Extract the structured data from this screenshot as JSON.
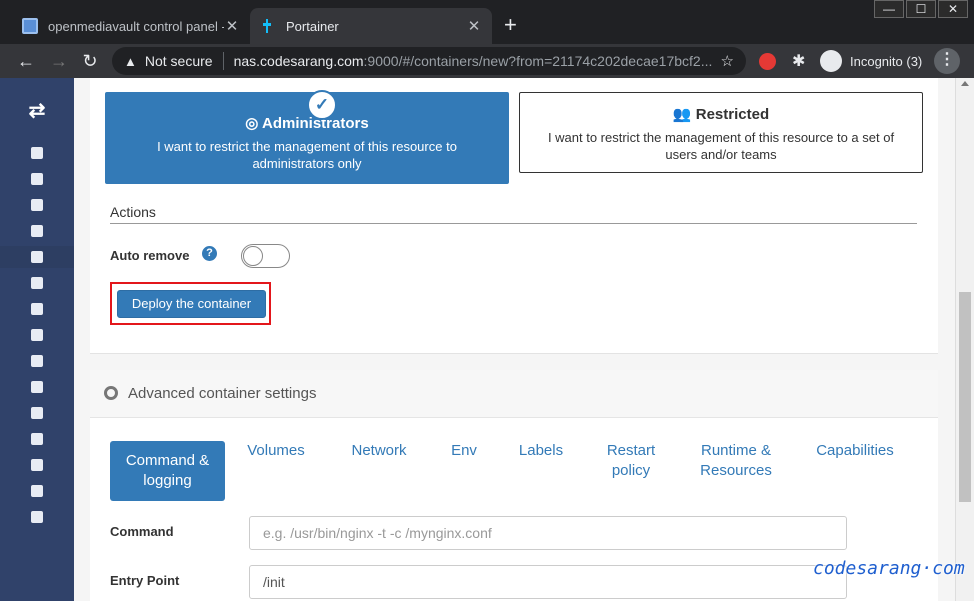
{
  "browser": {
    "tabs": [
      {
        "title": "openmediavault control panel - c",
        "active": false,
        "favicon": "omv-icon"
      },
      {
        "title": "Portainer",
        "active": true,
        "favicon": "portainer-icon"
      }
    ],
    "new_tab": "+",
    "window_controls": [
      "—",
      "☐",
      "✕"
    ],
    "security_label": "Not secure",
    "url_host": "nas.codesarang.com",
    "url_path": ":9000/#/containers/new?from=21174c202decae17bcf2...",
    "incognito_label": "Incognito (3)"
  },
  "sidebar": {
    "logo": "⇄",
    "items": [
      "home-icon",
      "dashboard-icon",
      "app-templates-icon",
      "stacks-icon",
      "containers-icon",
      "images-icon",
      "networks-icon",
      "volumes-icon",
      "events-icon",
      "host-icon",
      "extensions-icon",
      "users-icon",
      "endpoints-icon",
      "registries-icon",
      "settings-icon"
    ],
    "active_index": 4
  },
  "access_control": {
    "admin": {
      "title": "Administrators",
      "description": "I want to restrict the management of this resource to administrators only",
      "selected": true
    },
    "restricted": {
      "title": "Restricted",
      "description": "I want to restrict the management of this resource to a set of users and/or teams",
      "selected": false
    }
  },
  "actions": {
    "title": "Actions",
    "auto_remove_label": "Auto remove",
    "auto_remove_on": false,
    "help": "?",
    "deploy_label": "Deploy the container"
  },
  "advanced": {
    "title": "Advanced container settings",
    "tabs": [
      "Command & logging",
      "Volumes",
      "Network",
      "Env",
      "Labels",
      "Restart policy",
      "Runtime & Resources",
      "Capabilities"
    ],
    "active_tab": 0,
    "command_label": "Command",
    "command_placeholder": "e.g. /usr/bin/nginx -t -c /mynginx.conf",
    "entrypoint_label": "Entry Point",
    "entrypoint_value": "/init"
  },
  "watermark": "codesarang·com",
  "colors": {
    "primary": "#337ab7",
    "sidebar": "#30426a",
    "highlight": "#e3161b"
  }
}
